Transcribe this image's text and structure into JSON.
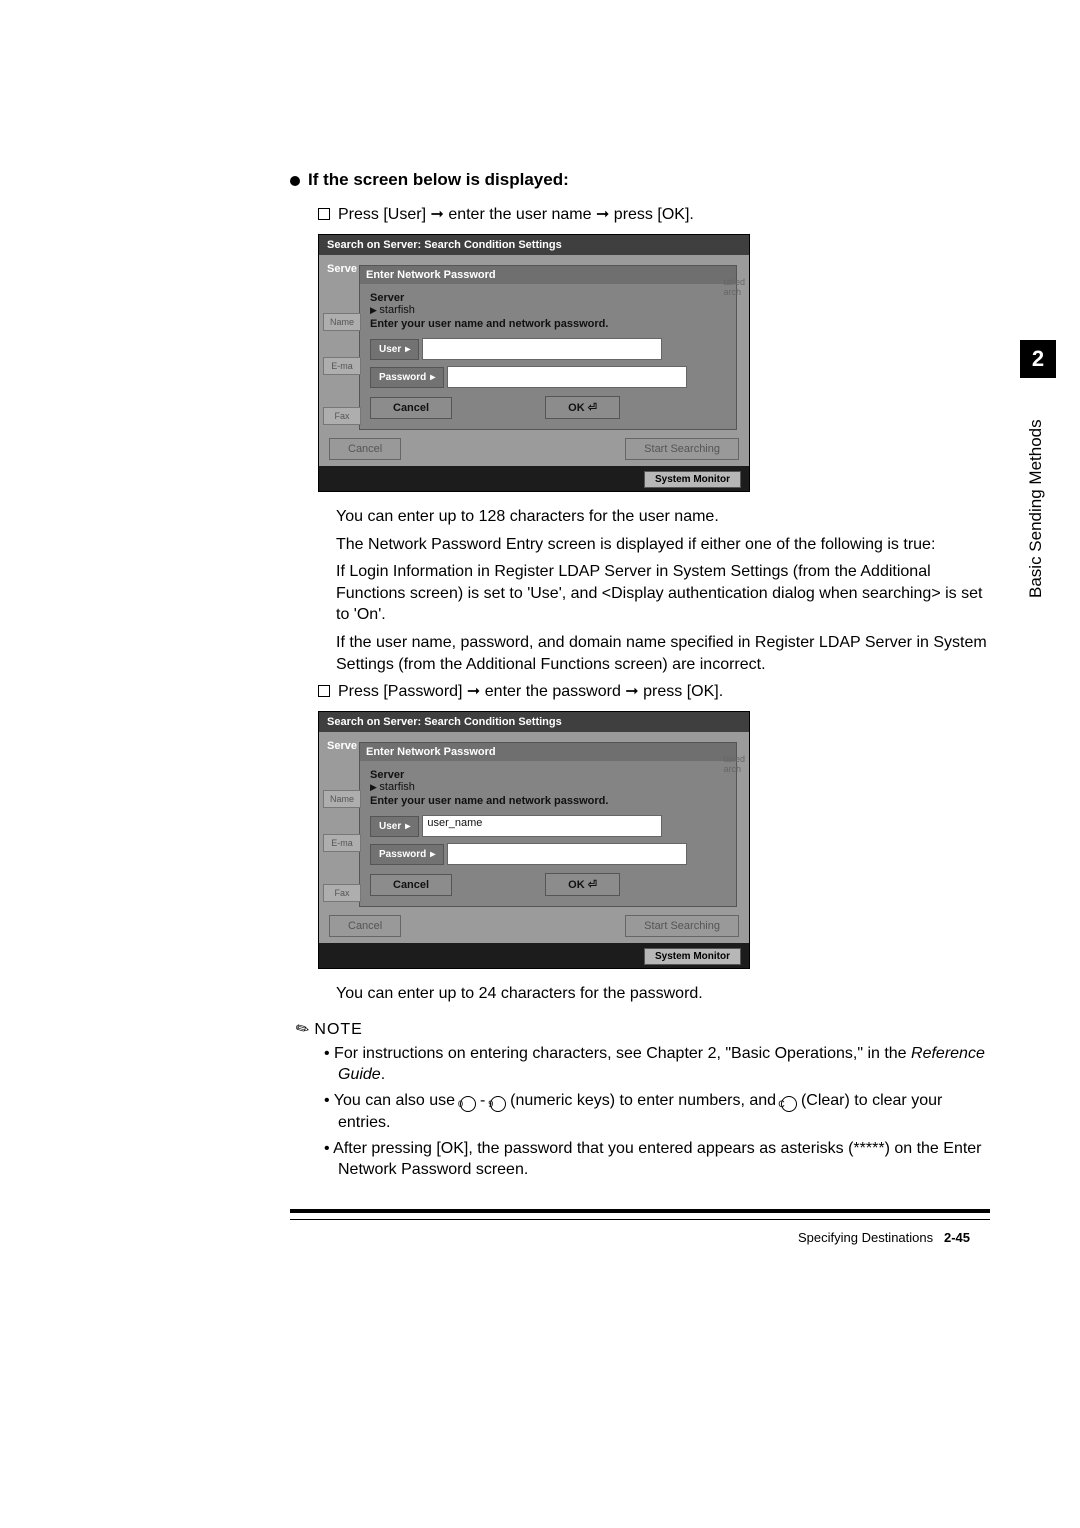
{
  "section": {
    "heading": "If the screen below is displayed:",
    "step1": "Press [User] ➞ enter the user name ➞ press [OK].",
    "step2": "Press [Password] ➞ enter the password ➞ press [OK]."
  },
  "screenshot": {
    "title": "Search on Server: Search Condition Settings",
    "modal_title": "Enter Network Password",
    "server_label": "Server",
    "server_name": "starfish",
    "instruction": "Enter your user name and network password.",
    "user_label": "User",
    "password_label": "Password",
    "cancel": "Cancel",
    "ok": "OK",
    "big_cancel": "Cancel",
    "start_search": "Start Searching",
    "system_monitor": "System Monitor",
    "serve_prefix": "Serve",
    "side_name": "Name",
    "side_email": "E-ma",
    "side_fax": "Fax",
    "user_value": "user_name"
  },
  "body": {
    "p1": "You can enter up to 128 characters for the user name.",
    "p2": "The Network Password Entry screen is displayed if either one of the following is true:",
    "p3": "If Login Information in Register LDAP Server in System Settings (from the Additional Functions screen) is set to 'Use', and <Display authentication dialog when searching> is set to 'On'.",
    "p4": "If the user name, password, and domain name specified in Register LDAP Server in System Settings (from the Additional Functions screen) are incorrect.",
    "p5": "You can enter up to 24 characters for the password."
  },
  "note": {
    "heading": "NOTE",
    "n1_a": "For instructions on entering characters, see Chapter 2, \"Basic Operations,\" in the ",
    "n1_b": "Reference Guide",
    "n1_c": ".",
    "n2_a": "You can also use ",
    "n2_b": " - ",
    "n2_c": " (numeric keys) to enter numbers, and ",
    "n2_d": " (Clear) to clear your entries.",
    "n3": "After pressing [OK], the password that you entered appears as asterisks (*****) on the Enter Network Password screen.",
    "key0": "0",
    "key9": "9",
    "keyC": "C"
  },
  "footer": {
    "title": "Specifying Destinations",
    "page": "2-45"
  },
  "tab": {
    "num": "2",
    "text": "Basic Sending Methods"
  }
}
